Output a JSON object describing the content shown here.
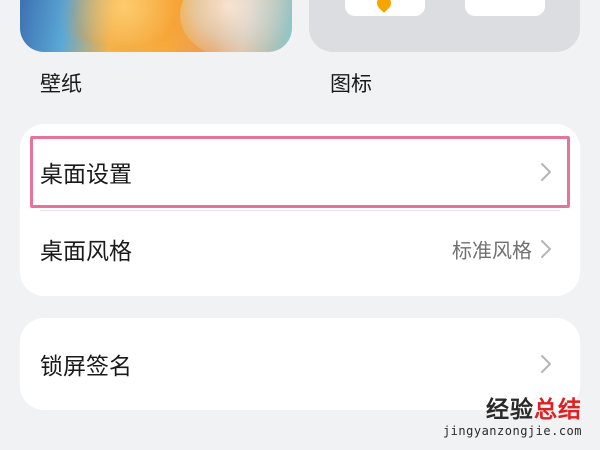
{
  "thumbnails": {
    "wallpaper_label": "壁纸",
    "icons_label": "图标"
  },
  "desktop_card": {
    "settings_label": "桌面设置",
    "style_label": "桌面风格",
    "style_value": "标准风格"
  },
  "lock_card": {
    "signature_label": "锁屏签名"
  },
  "watermark": {
    "title_part1": "经验",
    "title_part2": "总结",
    "url": "jingyanzongjie.com"
  },
  "colors": {
    "highlight_border": "#e8739a",
    "watermark_accent": "#e02020",
    "icon_pin": "#f6a400"
  }
}
